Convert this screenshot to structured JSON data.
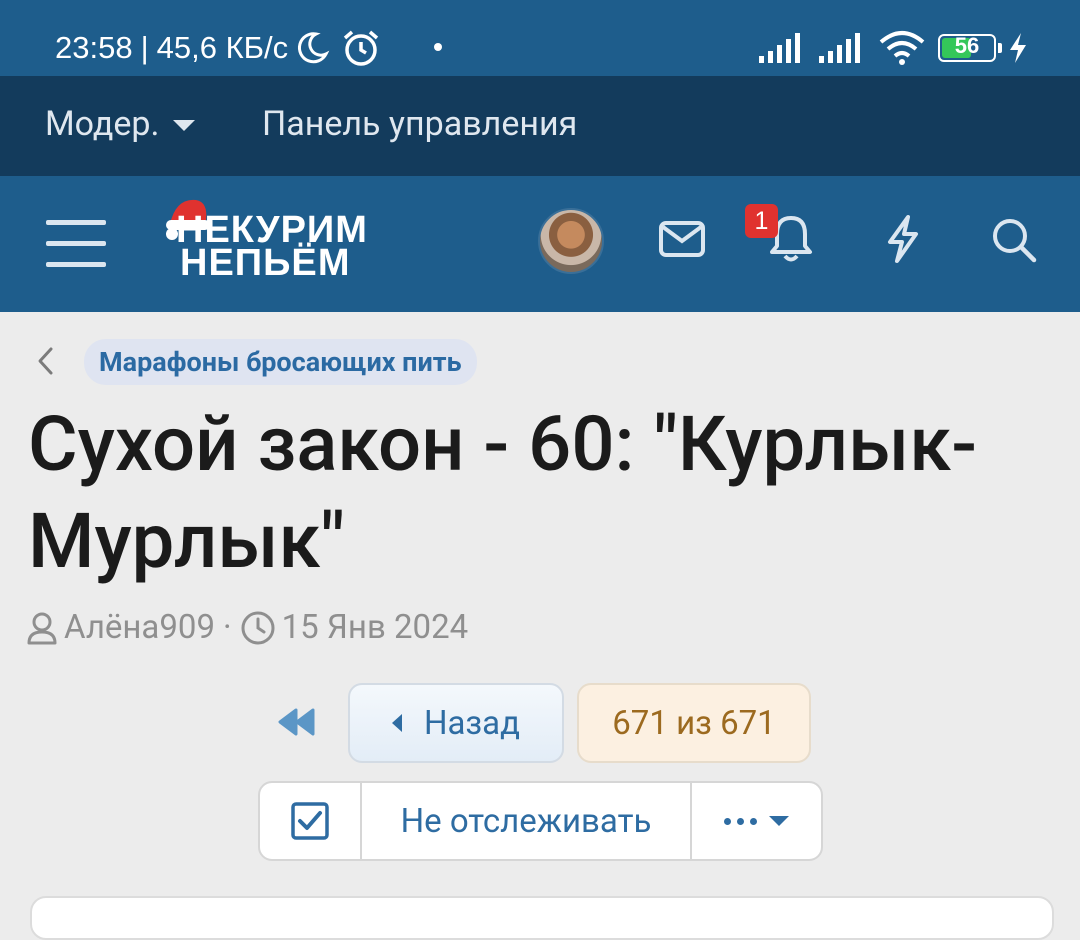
{
  "status_bar": {
    "time": "23:58",
    "separator": "|",
    "speed": "45,6 КБ/с",
    "battery": "56"
  },
  "mod_bar": {
    "moderator_label": "Модер.",
    "panel_label": "Панель управления"
  },
  "header": {
    "logo_line1": "НЕКУРИМ",
    "logo_line2": "НЕПЬЁМ",
    "notification_count": "1"
  },
  "thread": {
    "forum": "Марафоны бросающих пить",
    "title": "Сухой закон - 60: \"Курлык-Мурлык\"",
    "author": "Алёна909",
    "meta_separator": "·",
    "date": "15 Янв 2024"
  },
  "pager": {
    "back_label": "Назад",
    "page_info": "671 из 671"
  },
  "actions": {
    "watch_label": "Не отслеживать"
  },
  "colors": {
    "header_bg": "#1e5d8c",
    "modbar_bg": "#133b5c",
    "link": "#2e6ca2",
    "badge": "#e0322f"
  },
  "icons": {
    "moon": "moon-icon",
    "alarm": "alarm-icon",
    "signal": "signal-icon",
    "wifi": "wifi-icon",
    "charging": "lightning-icon",
    "menu": "hamburger-icon",
    "mail": "mail-icon",
    "bell": "bell-icon",
    "flash": "lightning-icon",
    "search": "search-icon",
    "user": "user-icon",
    "clock": "clock-icon",
    "first_page": "double-chevron-left-icon",
    "check": "checkbox-icon"
  }
}
